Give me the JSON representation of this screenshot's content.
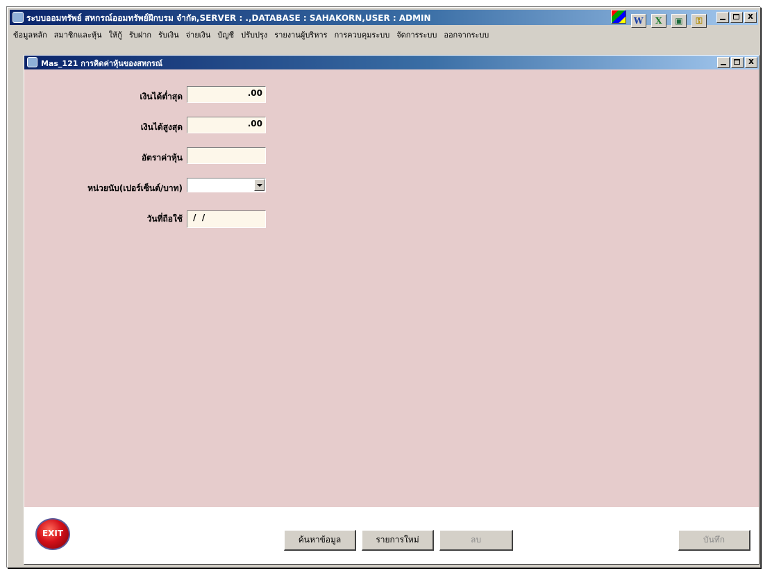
{
  "window": {
    "title": "ระบบออมทรัพย์ สหกรณ์ออมทรัพย์ฝึกบรม จำกัด,SERVER : .,DATABASE : SAHAKORN,USER : ADMIN",
    "app_icons": [
      "color-palette-icon",
      "word-icon",
      "excel-icon",
      "screen-icon",
      "key-icon"
    ],
    "controls": {
      "minimize": "_",
      "maximize": "□",
      "close": "x"
    }
  },
  "menubar": {
    "items": [
      "ข้อมูลหลัก",
      "สมาชิกและหุ้น",
      "ให้กู้",
      "รับฝาก",
      "รับเงิน",
      "จ่ายเงิน",
      "บัญชี",
      "ปรับปรุง",
      "รายงานผู้บริหาร",
      "การควบคุมระบบ",
      "จัดการระบบ",
      "ออกจากระบบ"
    ]
  },
  "form": {
    "title": "Mas_121 การคิดค่าหุ้นของสหกรณ์",
    "fields": {
      "min_income": {
        "label": "เงินได้ต่ำสุด",
        "value": ".00"
      },
      "max_income": {
        "label": "เงินได้สูงสุด",
        "value": ".00"
      },
      "share_rate": {
        "label": "อัตราค่าหุ้น",
        "value": ""
      },
      "unit": {
        "label": "หน่วยนับ(เปอร์เซ็นต์/บาท)",
        "value": ""
      },
      "effective_date": {
        "label": "วันที่ถือใช้",
        "value": " /  /"
      }
    },
    "buttons": {
      "exit": "EXIT",
      "search": "ค้นหาข้อมูล",
      "new": "รายการใหม่",
      "delete": "ลบ",
      "save": "บันทึก"
    }
  },
  "colors": {
    "title_gradient_start": "#0a246a",
    "title_gradient_end": "#a6caf0",
    "form_background": "#e6cccc",
    "field_background": "#fdf7ea",
    "button_face": "#d4d0c8"
  }
}
